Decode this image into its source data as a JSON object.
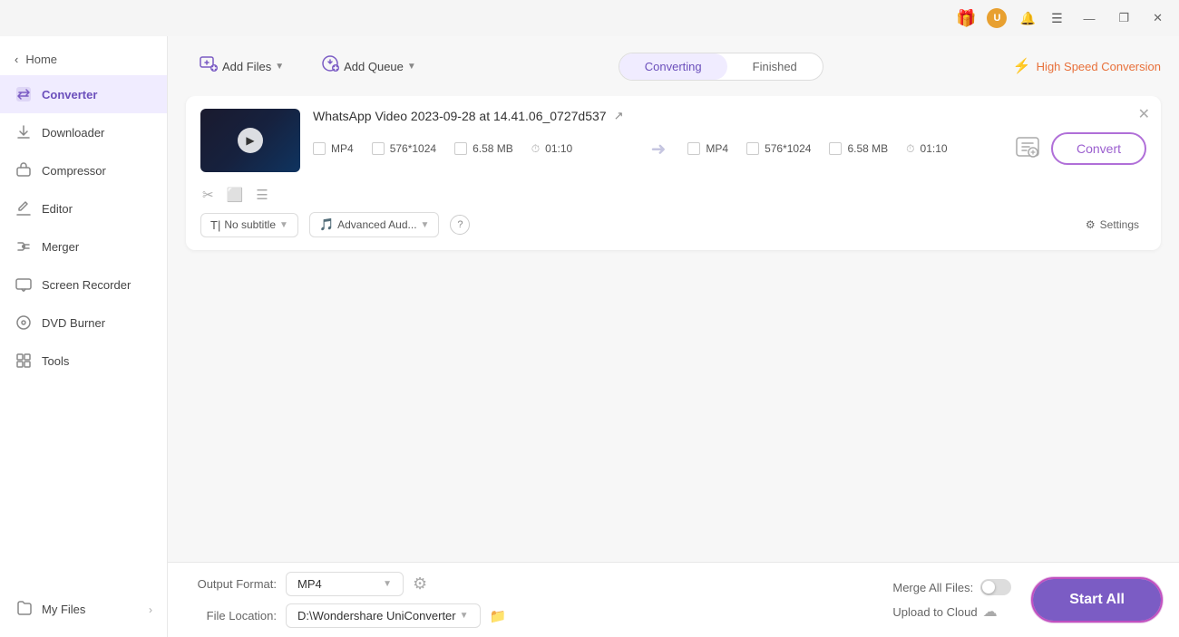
{
  "titlebar": {
    "avatar_text": "U",
    "minimize": "—",
    "maximize": "❐",
    "close": "✕"
  },
  "sidebar": {
    "back_label": "Home",
    "items": [
      {
        "id": "converter",
        "label": "Converter",
        "active": true
      },
      {
        "id": "downloader",
        "label": "Downloader",
        "active": false
      },
      {
        "id": "compressor",
        "label": "Compressor",
        "active": false
      },
      {
        "id": "editor",
        "label": "Editor",
        "active": false
      },
      {
        "id": "merger",
        "label": "Merger",
        "active": false
      },
      {
        "id": "screen-recorder",
        "label": "Screen Recorder",
        "active": false
      },
      {
        "id": "dvd-burner",
        "label": "DVD Burner",
        "active": false
      },
      {
        "id": "tools",
        "label": "Tools",
        "active": false
      }
    ],
    "my_files_label": "My Files"
  },
  "toolbar": {
    "add_files_label": "Add Files",
    "add_queue_label": "Add Queue",
    "tab_converting": "Converting",
    "tab_finished": "Finished",
    "high_speed_label": "High Speed Conversion"
  },
  "file_card": {
    "filename": "WhatsApp Video 2023-09-28 at 14.41.06_0727d537",
    "source": {
      "format": "MP4",
      "resolution": "576*1024",
      "size": "6.58 MB",
      "duration": "01:10"
    },
    "target": {
      "format": "MP4",
      "resolution": "576*1024",
      "size": "6.58 MB",
      "duration": "01:10"
    },
    "convert_btn_label": "Convert",
    "subtitle_label": "No subtitle",
    "audio_label": "Advanced Aud...",
    "settings_label": "Settings"
  },
  "bottom_bar": {
    "output_format_label": "Output Format:",
    "output_format_value": "MP4",
    "file_location_label": "File Location:",
    "file_location_value": "D:\\Wondershare UniConverter",
    "merge_files_label": "Merge All Files:",
    "upload_cloud_label": "Upload to Cloud",
    "start_all_label": "Start All"
  }
}
